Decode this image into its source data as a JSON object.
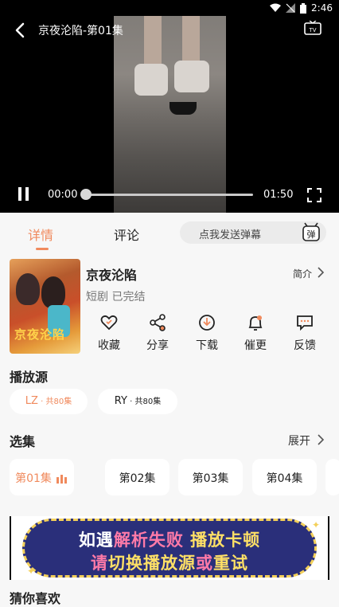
{
  "status": {
    "time": "2:46"
  },
  "video": {
    "title": "京夜沦陷-第01集",
    "current_time": "00:00",
    "total_time": "01:50",
    "progress_fraction": 0.0
  },
  "tabs": {
    "details": "详情",
    "comments": "评论",
    "danmu_placeholder": "点我发送弹幕",
    "danmu_icon_char": "弹"
  },
  "drama": {
    "poster_text": "京夜沦陷",
    "title": "京夜沦陷",
    "subtitle": "短剧 已完结",
    "intro_label": "简介",
    "actions": {
      "favorite": "收藏",
      "share": "分享",
      "download": "下载",
      "remind": "催更",
      "feedback": "反馈"
    }
  },
  "sources": {
    "section_title": "播放源",
    "items": [
      {
        "name": "LZ",
        "sep": " · ",
        "count": "共80集"
      },
      {
        "name": "RY",
        "sep": " · ",
        "count": "共80集"
      }
    ]
  },
  "episodes": {
    "section_title": "选集",
    "expand_label": "展开",
    "items": [
      "第01集",
      "第02集",
      "第03集",
      "第04集"
    ]
  },
  "banner": {
    "line1": {
      "a": "如遇",
      "b": "解析失败",
      "c": " 播放卡顿"
    },
    "line2": {
      "a": "请",
      "b": "切换播放源",
      "c": "或",
      "d": "重试"
    }
  },
  "recommend": {
    "section_title": "猜你喜欢"
  },
  "colors": {
    "accent": "#f08a5d",
    "banner_bg": "#2a2f7a",
    "banner_border": "#f3d05a"
  }
}
